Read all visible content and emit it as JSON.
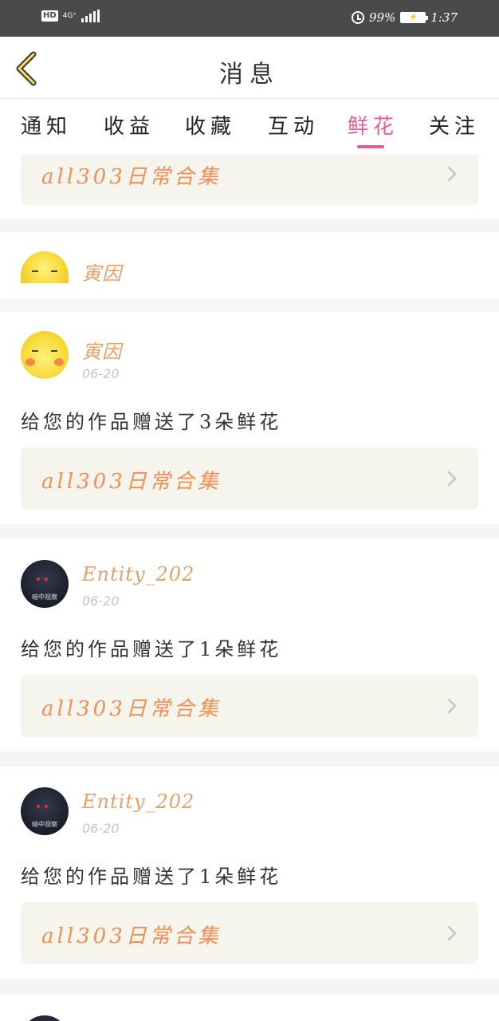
{
  "status_bar": {
    "hd": "HD",
    "network": "4G⁺",
    "battery_percent": "99%",
    "time": "1:37"
  },
  "header": {
    "title": "消息"
  },
  "tabs": [
    {
      "label": "通知",
      "active": false
    },
    {
      "label": "收益",
      "active": false
    },
    {
      "label": "收藏",
      "active": false
    },
    {
      "label": "互动",
      "active": false
    },
    {
      "label": "鲜花",
      "active": true
    },
    {
      "label": "关注",
      "active": false
    }
  ],
  "items": [
    {
      "work_title": "all303日常合集"
    },
    {
      "user": "寅因"
    },
    {
      "user": "寅因",
      "date": "06-20",
      "message": "给您的作品赠送了3朵鲜花",
      "work_title": "all303日常合集"
    },
    {
      "user": "Entity_202",
      "avatar_caption": "暗中观察",
      "date": "06-20",
      "message": "给您的作品赠送了1朵鲜花",
      "work_title": "all303日常合集"
    },
    {
      "user": "Entity_202",
      "avatar_caption": "暗中观察",
      "date": "06-20",
      "message": "给您的作品赠送了1朵鲜花",
      "work_title": "all303日常合集"
    }
  ],
  "colors": {
    "accent": "#e05f98",
    "username": "#e7a067",
    "work_title": "#ef8f54",
    "status_bar": "#4a4a4a"
  }
}
